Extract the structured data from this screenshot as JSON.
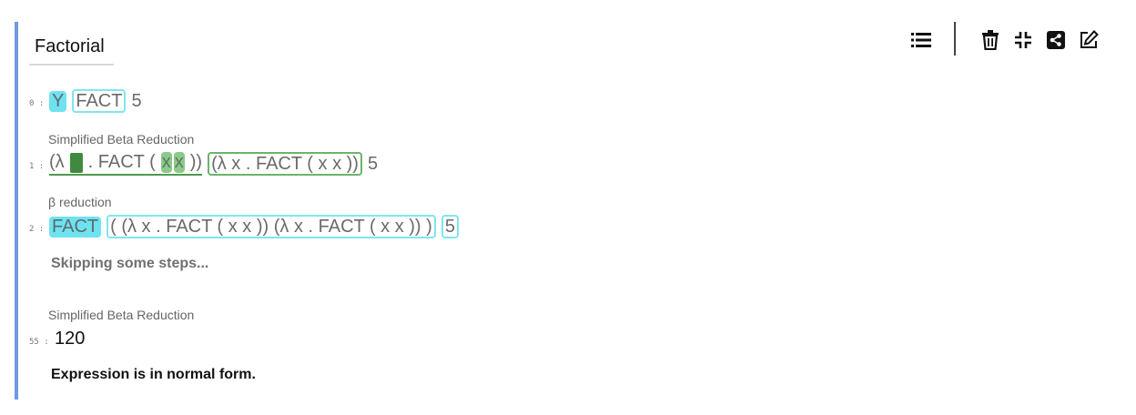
{
  "cell": {
    "title": "Factorial"
  },
  "toolbar": {
    "icons": [
      "list-icon",
      "trash-icon",
      "collapse-icon",
      "share-icon",
      "edit-icon"
    ]
  },
  "steps": {
    "s0": {
      "index": "0 :",
      "parts": [
        "Y",
        "FACT",
        "5"
      ]
    },
    "s1": {
      "index": "1 :",
      "caption": "Simplified Beta Reduction",
      "parts": [
        "(λ",
        ". FACT (",
        "x",
        "x",
        "))",
        "(λ x . FACT ( x x ))",
        "5"
      ]
    },
    "s2": {
      "index": "2 :",
      "caption": "β reduction",
      "parts": [
        "FACT",
        "( (λ x . FACT ( x x )) (λ x . FACT ( x x )) )",
        "5"
      ]
    },
    "skip_note": "Skipping some steps...",
    "s55": {
      "index": "55 :",
      "caption": "Simplified Beta Reduction",
      "result": "120"
    },
    "final_note": "Expression is in normal form."
  },
  "colors": {
    "accent_border": "#6c9be6",
    "cyan_highlight": "#6ee3ef",
    "green_box": "#6ab56a",
    "green_fill": "#8cc98c",
    "dark_green": "#3f8a3f"
  }
}
